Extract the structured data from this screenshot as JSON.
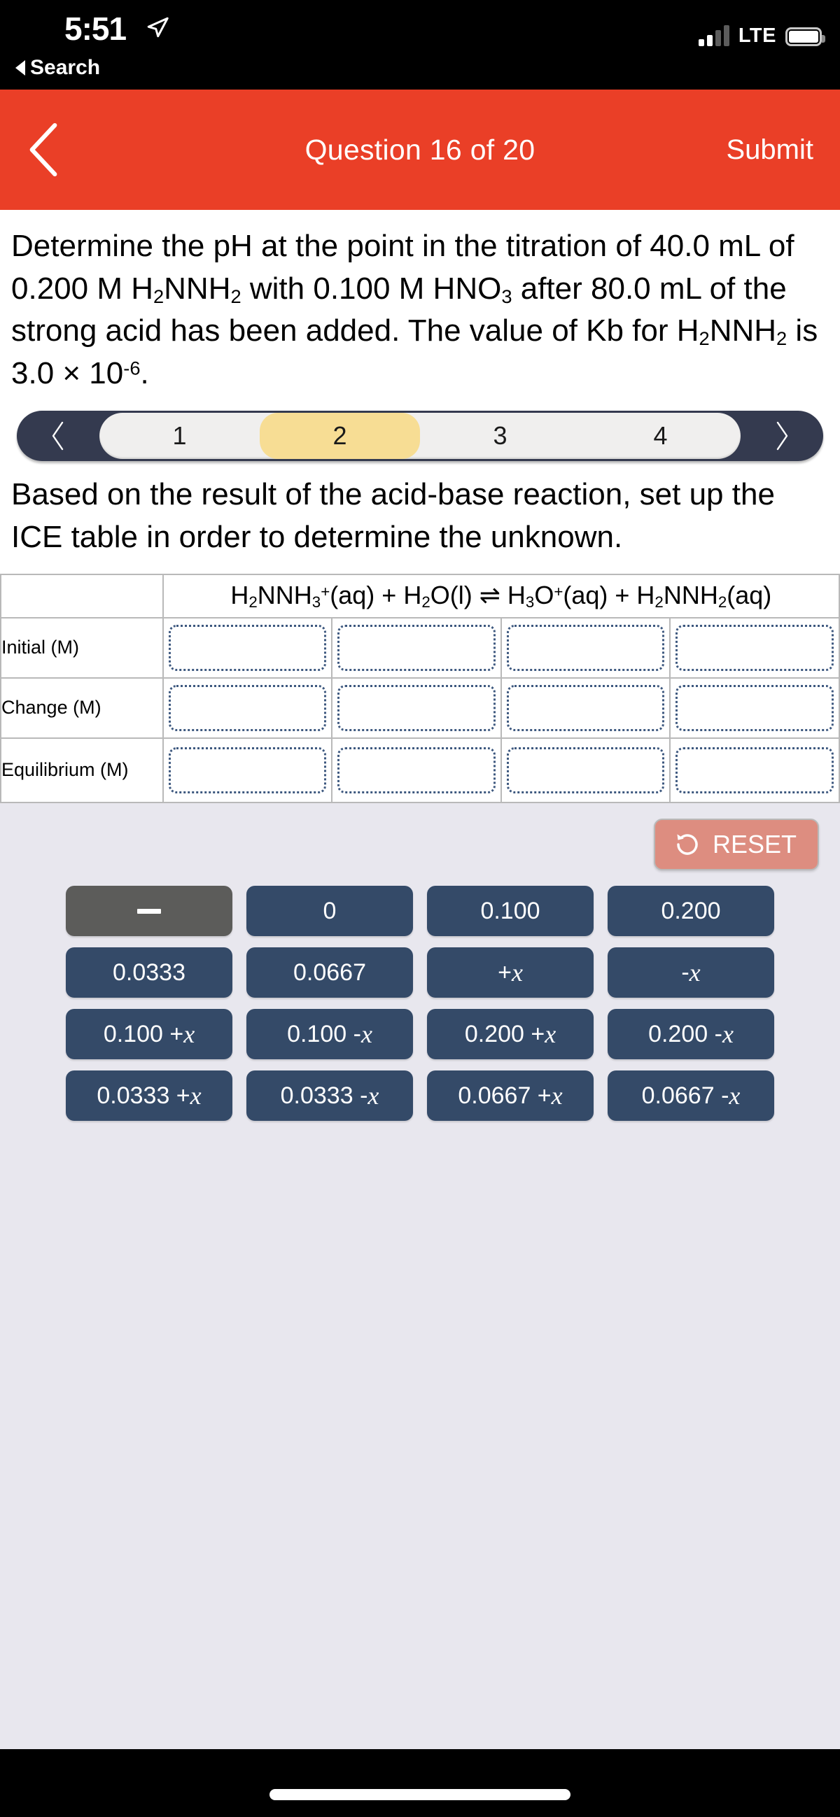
{
  "status_bar": {
    "time": "5:51",
    "back_label": "Search",
    "network": "LTE",
    "location_icon": "location-arrow-icon",
    "battery_icon": "battery-full-icon",
    "signal_icon": "signal-bars-icon"
  },
  "app_bar": {
    "back_icon": "chevron-left-icon",
    "title": "Question 16 of 20",
    "submit_label": "Submit",
    "background_color": "#ea3f27"
  },
  "question": {
    "parts": [
      "Determine the pH at the point in the titration of 40.0 mL of 0.200 M H",
      "2",
      "NNH",
      "2",
      " with 0.100 M HNO",
      "3",
      " after 80.0 mL of the strong acid has been added. The value of Kb for H",
      "2",
      "NNH",
      "2",
      " is 3.0 × 10",
      "-6",
      "."
    ],
    "text": "Determine the pH at the point in the titration of 40.0 mL of 0.200 M H2NNH2 with 0.100 M HNO3 after 80.0 mL of the strong acid has been added. The value of Kb for H2NNH2 is 3.0 × 10-6."
  },
  "step_nav": {
    "prev_icon": "chevron-left-icon",
    "next_icon": "chevron-right-icon",
    "steps": [
      "1",
      "2",
      "3",
      "4"
    ],
    "active_step": "2",
    "track_color": "#343a4f",
    "active_color": "#f7dd94"
  },
  "instruction": "Based on the result of the acid-base reaction, set up the ICE table in order to determine the unknown.",
  "ice_table": {
    "equation": {
      "reactant_1": "H2NNH3+(aq)",
      "plus_1": "+",
      "reactant_2": "H2O(l)",
      "arrow": "⇌",
      "product_1": "H3O+(aq)",
      "plus_2": "+",
      "product_2": "H2NNH2(aq)"
    },
    "column_headers": [
      "H2NNH3+(aq)",
      "H2O(l)",
      "H3O+(aq)",
      "H2NNH2(aq)"
    ],
    "row_labels": [
      "Initial (M)",
      "Change (M)",
      "Equilibrium (M)"
    ],
    "cells": [
      [
        "",
        "",
        "",
        ""
      ],
      [
        "",
        "",
        "",
        ""
      ],
      [
        "",
        "",
        "",
        ""
      ]
    ]
  },
  "tray": {
    "reset_label": "RESET",
    "reset_icon": "rotate-ccw-icon",
    "reset_color": "#dd8d80",
    "tile_color": "#344a68",
    "tiles": [
      {
        "label": "—",
        "type": "dash",
        "muted": true
      },
      {
        "label": "0",
        "type": "text",
        "muted": false
      },
      {
        "label": "0.100",
        "type": "text",
        "muted": false
      },
      {
        "label": "0.200",
        "type": "text",
        "muted": false
      },
      {
        "label": "0.0333",
        "type": "text",
        "muted": false
      },
      {
        "label": "0.0667",
        "type": "text",
        "muted": false
      },
      {
        "label": "+x",
        "type": "expr",
        "prefix": "+",
        "var": "x",
        "muted": false
      },
      {
        "label": "-x",
        "type": "expr",
        "prefix": "-",
        "var": "x",
        "muted": false
      },
      {
        "label": "0.100 + x",
        "type": "expr",
        "prefix": "0.100 + ",
        "var": "x",
        "muted": false
      },
      {
        "label": "0.100 - x",
        "type": "expr",
        "prefix": "0.100 - ",
        "var": "x",
        "muted": false
      },
      {
        "label": "0.200 + x",
        "type": "expr",
        "prefix": "0.200 + ",
        "var": "x",
        "muted": false
      },
      {
        "label": "0.200 - x",
        "type": "expr",
        "prefix": "0.200 - ",
        "var": "x",
        "muted": false
      },
      {
        "label": "0.0333 + x",
        "type": "expr",
        "prefix": "0.0333 + ",
        "var": "x",
        "muted": false
      },
      {
        "label": "0.0333 - x",
        "type": "expr",
        "prefix": "0.0333 - ",
        "var": "x",
        "muted": false
      },
      {
        "label": "0.0667 + x",
        "type": "expr",
        "prefix": "0.0667 + ",
        "var": "x",
        "muted": false
      },
      {
        "label": "0.0667 - x",
        "type": "expr",
        "prefix": "0.0667 - ",
        "var": "x",
        "muted": false
      }
    ]
  },
  "home_indicator": "home-bar"
}
